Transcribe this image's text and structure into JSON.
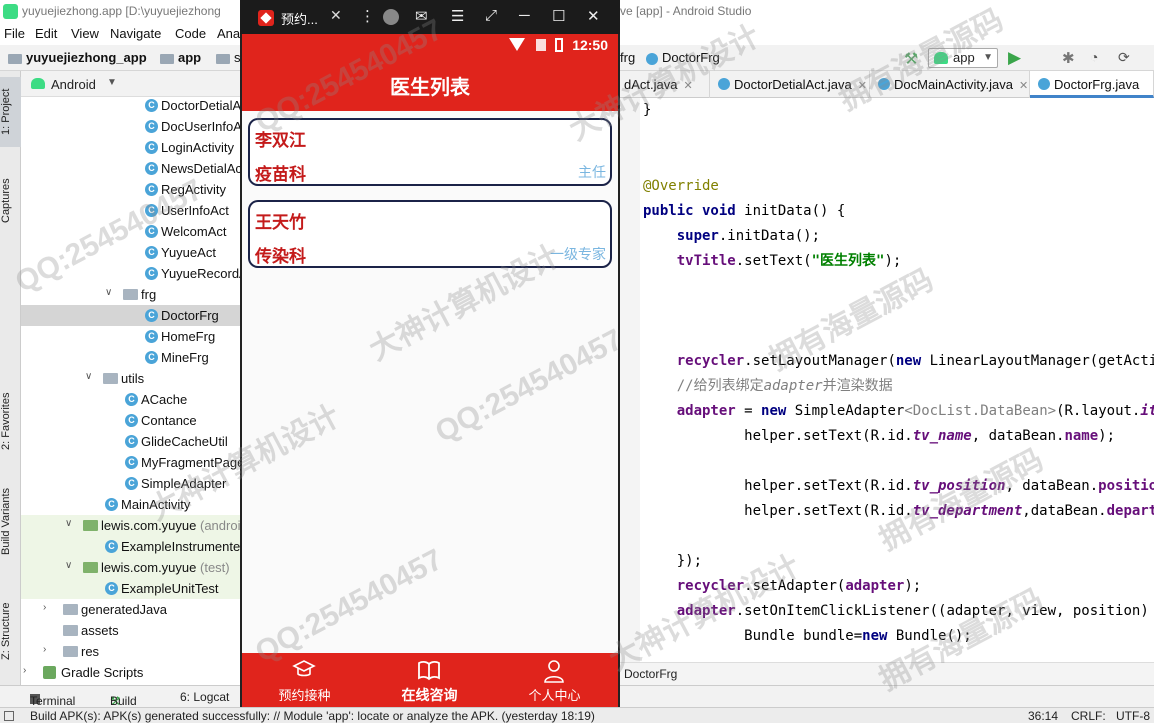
{
  "window": {
    "title_left": "yuyuejiezhong.app [D:\\yuyuejiezhong",
    "title_right": "ve [app] - Android Studio"
  },
  "menu": [
    "File",
    "Edit",
    "View",
    "Navigate",
    "Code",
    "Ana"
  ],
  "nav": {
    "project": "yuyuejiezhong_app",
    "module": "app",
    "s_fragment": "s",
    "crumb_right": "frg",
    "crumb_file": "DoctorFrg",
    "run_config": "app"
  },
  "project_pane": {
    "view_label": "Android",
    "items": [
      {
        "label": "DoctorDetialA",
        "type": "class"
      },
      {
        "label": "DocUserInfoA",
        "type": "class"
      },
      {
        "label": "LoginActivity",
        "type": "class"
      },
      {
        "label": "NewsDetialAc",
        "type": "class"
      },
      {
        "label": "RegActivity",
        "type": "class"
      },
      {
        "label": "UserInfoAct",
        "type": "class"
      },
      {
        "label": "WelcomAct",
        "type": "class"
      },
      {
        "label": "YuyueAct",
        "type": "class"
      },
      {
        "label": "YuyueRecordA",
        "type": "class"
      },
      {
        "label": "frg",
        "type": "folder"
      },
      {
        "label": "DoctorFrg",
        "type": "class"
      },
      {
        "label": "HomeFrg",
        "type": "class"
      },
      {
        "label": "MineFrg",
        "type": "class"
      },
      {
        "label": "utils",
        "type": "folder"
      },
      {
        "label": "ACache",
        "type": "class"
      },
      {
        "label": "Contance",
        "type": "class"
      },
      {
        "label": "GlideCacheUtil",
        "type": "class"
      },
      {
        "label": "MyFragmentPage",
        "type": "class"
      },
      {
        "label": "SimpleAdapter",
        "type": "class"
      },
      {
        "label": "MainActivity",
        "type": "class"
      },
      {
        "label": "lewis.com.yuyue",
        "hint": "(androi",
        "type": "folder"
      },
      {
        "label": "ExampleInstrumente",
        "type": "class"
      },
      {
        "label": "lewis.com.yuyue",
        "hint": "(test)",
        "type": "folder"
      },
      {
        "label": "ExampleUnitTest",
        "type": "class"
      },
      {
        "label": "generatedJava",
        "type": "folder"
      },
      {
        "label": "assets",
        "type": "folder"
      },
      {
        "label": "res",
        "type": "folder"
      },
      {
        "label": "Gradle Scripts",
        "type": "gradle"
      }
    ]
  },
  "side_tabs": [
    "1: Project",
    "Captures",
    "2: Favorites",
    "Build Variants",
    "Z: Structure"
  ],
  "editor_tabs": [
    {
      "label": "dAct.java"
    },
    {
      "label": "DoctorDetialAct.java"
    },
    {
      "label": "DocMainActivity.java"
    },
    {
      "label": "DoctorFrg.java",
      "active": true
    }
  ],
  "code_lines": [
    "}",
    "",
    "",
    "@Override",
    "public void initData() {",
    "    super.initData();",
    "    tvTitle.setText(\"医生列表\");",
    "",
    "",
    "",
    "    recycler.setLayoutManager(new LinearLayoutManager(getActivi",
    "    //给列表绑定adapter并渲染数据",
    "    adapter = new SimpleAdapter<DocList.DataBean>(R.layout.ite",
    "            helper.setText(R.id.tv_name, dataBean.name);",
    "",
    "            helper.setText(R.id.tv_position, dataBean.positio",
    "            helper.setText(R.id.tv_department,dataBean.departm",
    "",
    "    });",
    "    recycler.setAdapter(adapter);",
    "    adapter.setOnItemClickListener((adapter, view, position)",
    "            Bundle bundle=new Bundle();"
  ],
  "editor_footer": "DoctorFrg",
  "bottom_tabs": [
    "Terminal",
    "Build",
    "6: Logcat"
  ],
  "status_bar": {
    "message": "Build APK(s): APK(s) generated successfully: // Module 'app': locate or analyze the APK. (yesterday 18:19)",
    "position": "36:14",
    "line_sep": "CRLF:",
    "encoding": "UTF-8"
  },
  "emulator": {
    "tab_title": "预约...",
    "close": "✕",
    "time": "12:50",
    "screen_title": "医生列表",
    "doctors": [
      {
        "name": "李双江",
        "department": "疫苗科",
        "position": "主任"
      },
      {
        "name": "王天竹",
        "department": "传染科",
        "position": "一级专家"
      }
    ],
    "tabs": [
      {
        "label": "预约接种",
        "icon": "graduation-cap-icon"
      },
      {
        "label": "在线咨询",
        "icon": "open-book-icon",
        "active": true
      },
      {
        "label": "个人中心",
        "icon": "user-icon"
      }
    ],
    "accent_color": "#e0241c"
  },
  "watermarks": [
    "QQ:254540457",
    "大神计算机设计",
    "拥有海量源码",
    "QQ:254540457",
    "大神计算机设计",
    "拥有海量源码",
    "QQ:254540457",
    "大神计算机设计",
    "拥有海量源码",
    "QQ:254540457",
    "大神计算机设计",
    "拥有海量源码"
  ]
}
